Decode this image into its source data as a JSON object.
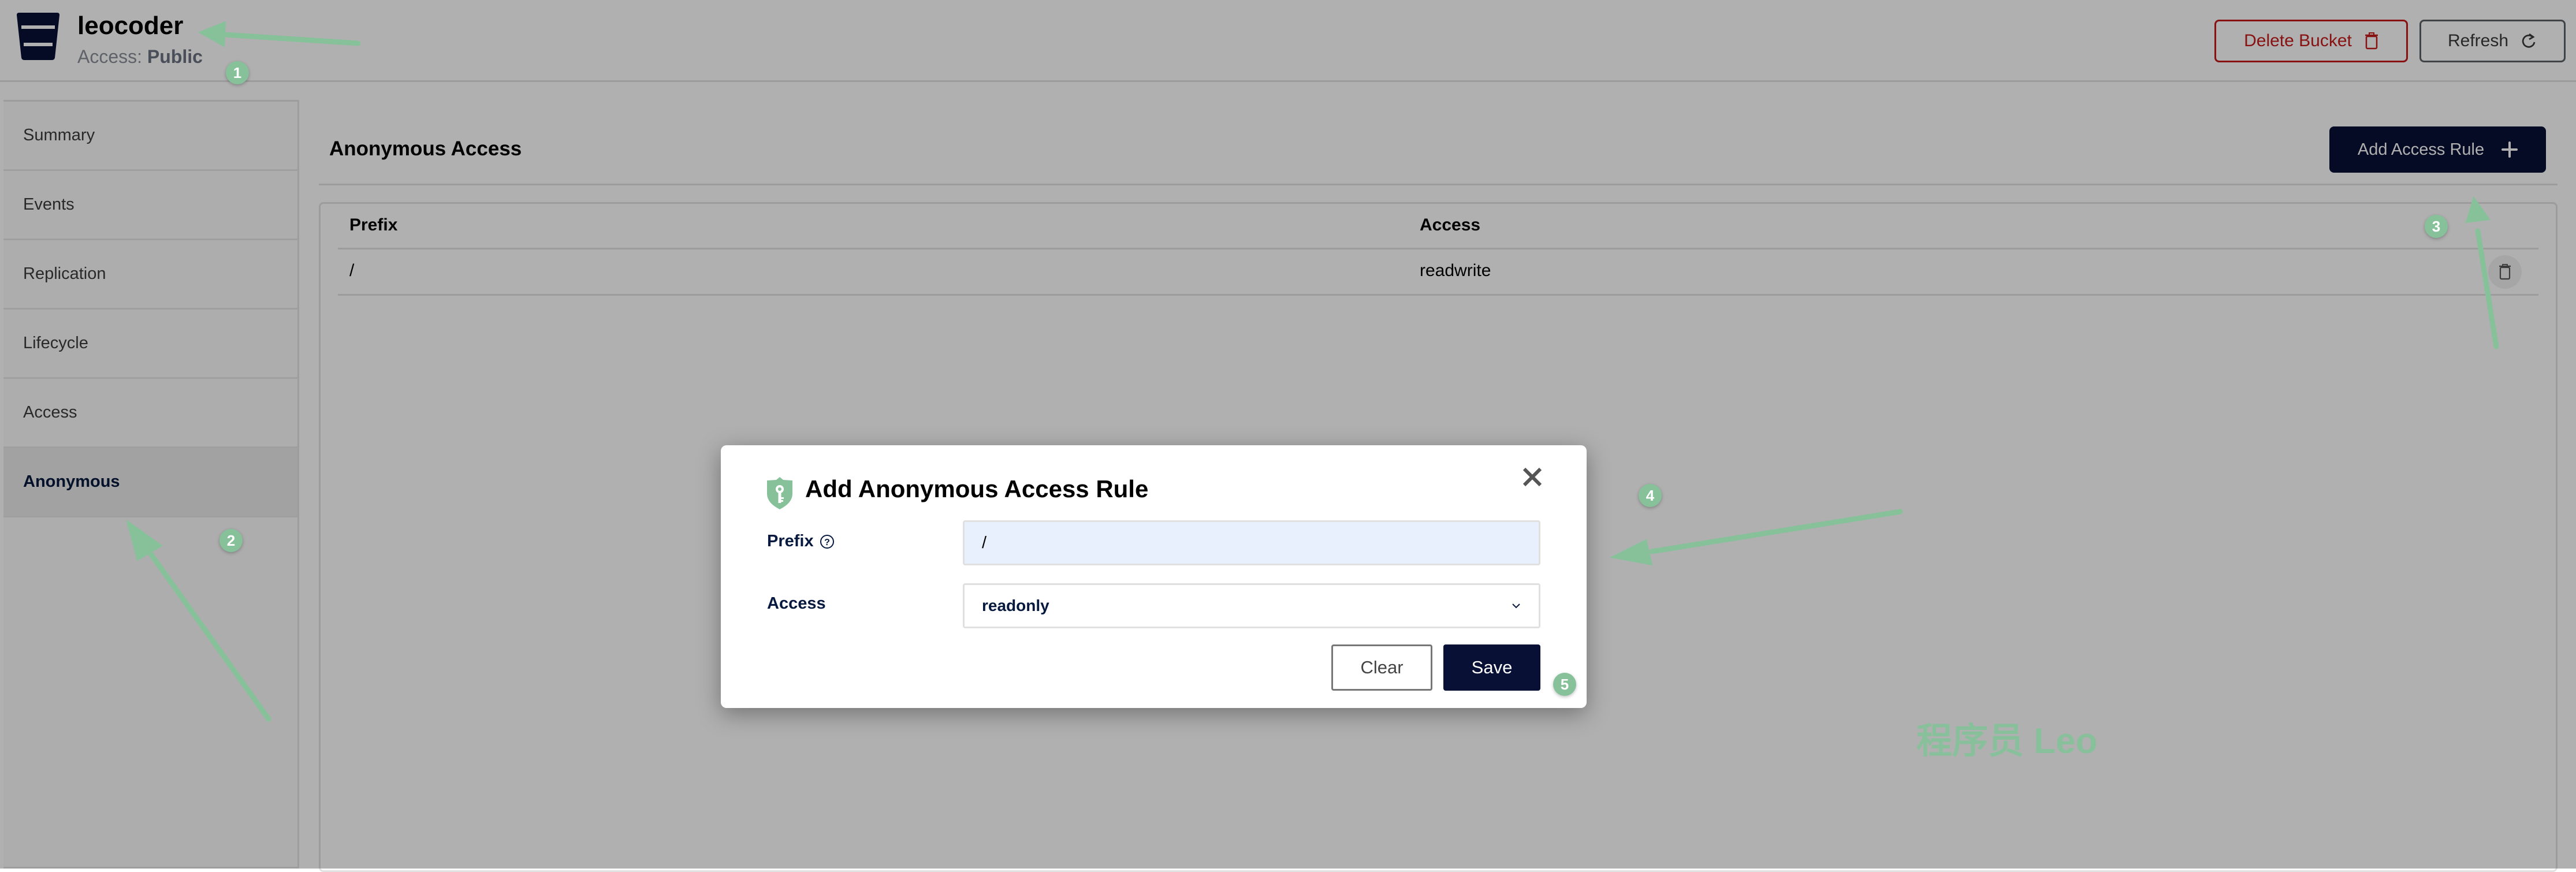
{
  "header": {
    "bucket_name": "leocoder",
    "access_label": "Access:",
    "access_value": "Public",
    "delete_button": "Delete Bucket",
    "refresh_button": "Refresh"
  },
  "sidebar": {
    "items": [
      {
        "label": "Summary",
        "active": false
      },
      {
        "label": "Events",
        "active": false
      },
      {
        "label": "Replication",
        "active": false
      },
      {
        "label": "Lifecycle",
        "active": false
      },
      {
        "label": "Access",
        "active": false
      },
      {
        "label": "Anonymous",
        "active": true
      }
    ]
  },
  "main": {
    "title": "Anonymous Access",
    "add_button": "Add Access Rule",
    "table": {
      "columns": [
        "Prefix",
        "Access"
      ],
      "rows": [
        {
          "prefix": "/",
          "access": "readwrite"
        }
      ]
    }
  },
  "modal": {
    "title": "Add Anonymous Access Rule",
    "prefix_label": "Prefix",
    "prefix_value": "/",
    "access_label": "Access",
    "access_value": "readonly",
    "clear_button": "Clear",
    "save_button": "Save"
  },
  "annotations": {
    "badges": [
      "1",
      "2",
      "3",
      "4",
      "5"
    ],
    "watermark": "程序员 Leo",
    "color": "#86c19a"
  },
  "colors": {
    "primary_dark": "#081036",
    "danger": "#c51b1b",
    "input_fill": "#e8f0fe"
  }
}
